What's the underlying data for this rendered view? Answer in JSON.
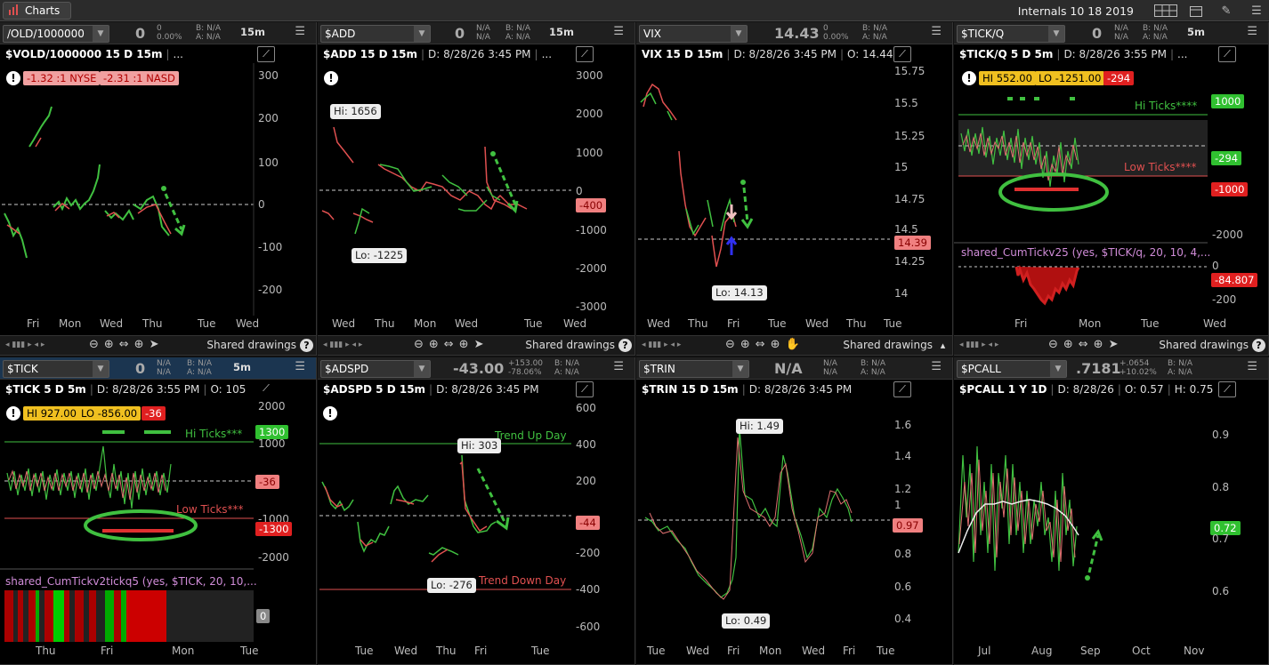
{
  "app": {
    "tab": "Charts",
    "title": "Internals 10 18 2019"
  },
  "panels": [
    {
      "id": "vold",
      "symbol": "/OLD/1000000",
      "bigval": "0",
      "small1": "0",
      "small2": "0.00%",
      "bn": "B: N/A",
      "an": "A: N/A",
      "tf": "15m",
      "status": "$VOLD/1000000 15 D 15m",
      "status_extra": "...",
      "badge1": "-1.32 :1 NYSE",
      "badge2": "-2.31 :1 NASD",
      "yticks": [
        "300",
        "200",
        "100",
        "0",
        "-100",
        "-200"
      ],
      "xticks": [
        "Fri",
        "Mon",
        "Wed",
        "Thu",
        "Tue",
        "Wed"
      ],
      "shared": "Shared drawings"
    },
    {
      "id": "add",
      "symbol": "$ADD",
      "bigval": "0",
      "small1": "N/A",
      "small2": "N/A",
      "bn": "B: N/A",
      "an": "A: N/A",
      "tf": "15m",
      "status": "$ADD 15 D 15m",
      "date": "D: 8/28/26 3:45 PM",
      "status_extra": "...",
      "hi": "Hi: 1656",
      "lo": "Lo: -1225",
      "lastbadge": "-400",
      "yticks": [
        "3000",
        "2000",
        "1000",
        "0",
        "-1000",
        "-2000",
        "-3000"
      ],
      "xticks": [
        "Wed",
        "Thu",
        "Mon",
        "Wed",
        "Tue",
        "Wed"
      ],
      "shared": "Shared drawings"
    },
    {
      "id": "vix",
      "symbol": "VIX",
      "bigval": "14.43",
      "small1": "0",
      "small2": "0.00%",
      "bn": "B: N/A",
      "an": "A: N/A",
      "status": "VIX 15 D 15m",
      "date": "D: 8/28/26 3:45 PM",
      "open": "O: 14.44",
      "lo": "Lo: 14.13",
      "lastbadge": "14.39",
      "yticks": [
        "15.75",
        "15.5",
        "15.25",
        "15",
        "14.75",
        "14.5",
        "14.25",
        "14"
      ],
      "xticks": [
        "Wed",
        "Thu",
        "Fri",
        "Tue",
        "Wed",
        "Thu",
        "Tue"
      ],
      "shared": "Shared drawings"
    },
    {
      "id": "tickq",
      "symbol": "$TICK/Q",
      "bigval": "0",
      "small1": "N/A",
      "small2": "N/A",
      "bn": "B: N/A",
      "an": "A: N/A",
      "tf": "5m",
      "status": "$TICK/Q 5 D 5m",
      "date": "D: 8/28/26 3:55 PM",
      "status_extra": "...",
      "hi": "HI 552.00",
      "lo": "LO -1251.00",
      "last": "-294",
      "hiTicks": "Hi Ticks****",
      "lowTicks": "Low Ticks****",
      "badge1000": "1000",
      "badgeLast": "-294",
      "badgeNeg": "-1000",
      "ytick_2000": "-2000",
      "study": "shared_CumTickv25 (yes, $TICK/q, 20, 10, 4,...",
      "studyVal": "-84.807",
      "studyTicks": [
        "0",
        "-200"
      ],
      "xticks": [
        "Fri",
        "Mon",
        "Tue",
        "Wed"
      ],
      "shared": "Shared drawings"
    },
    {
      "id": "tick",
      "symbol": "$TICK",
      "bigval": "0",
      "small1": "N/A",
      "small2": "N/A",
      "bn": "B: N/A",
      "an": "A: N/A",
      "tf": "5m",
      "status": "$TICK 5 D 5m",
      "date": "D: 8/28/26 3:55 PM",
      "open": "O: 105",
      "hi": "HI 927.00",
      "lo": "LO -856.00",
      "last": "-36",
      "hiTicks": "Hi Ticks***",
      "lowTicks": "Low Ticks***",
      "badge1300": "1300",
      "badgeLast": "-36",
      "badgeNeg": "-1300",
      "yticks": [
        "2000",
        "1000",
        "0",
        "-1000",
        "-2000"
      ],
      "study": "shared_CumTickv2tickq5 (yes, $TICK, 20, 10,...",
      "studyVal": "0",
      "xticks": [
        "Thu",
        "Fri",
        "Mon",
        "Tue"
      ]
    },
    {
      "id": "adspd",
      "symbol": "$ADSPD",
      "bigval": "-43.00",
      "small1": "+153.00",
      "small2": "-78.06%",
      "bn": "B: N/A",
      "an": "A: N/A",
      "status": "$ADSPD 5 D 15m",
      "date": "D: 8/28/26 3:45 PM",
      "hi": "Hi: 303",
      "lo": "Lo: -276",
      "trendUp": "Trend Up Day",
      "trendDown": "Trend Down Day",
      "lastbadge": "-44",
      "yticks": [
        "600",
        "400",
        "200",
        "0",
        "-200",
        "-400",
        "-600"
      ],
      "xticks": [
        "Tue",
        "Wed",
        "Thu",
        "Fri",
        "Tue"
      ]
    },
    {
      "id": "trin",
      "symbol": "$TRIN",
      "bigval": "N/A",
      "small1": "N/A",
      "small2": "N/A",
      "bn": "B: N/A",
      "an": "A: N/A",
      "status": "$TRIN 15 D 15m",
      "date": "D: 8/28/26 3:45 PM",
      "hi": "Hi: 1.49",
      "lo": "Lo: 0.49",
      "lastbadge": "0.97",
      "yticks": [
        "1.6",
        "1.4",
        "1.2",
        "1",
        "0.8",
        "0.6",
        "0.4"
      ],
      "xticks": [
        "Tue",
        "Wed",
        "Fri",
        "Mon",
        "Wed",
        "Fri",
        "Tue"
      ]
    },
    {
      "id": "pcall",
      "symbol": "$PCALL",
      "bigval": ".7181",
      "small1": "+.0654",
      "small2": "+10.02%",
      "bn": "B: N/A",
      "an": "A: N/A",
      "status": "$PCALL 1 Y 1D",
      "date": "D: 8/28/26",
      "open": "O: 0.57",
      "high": "H: 0.75",
      "lastbadge": "0.72",
      "yticks": [
        "0.9",
        "0.8",
        "0.7",
        "0.6"
      ],
      "xticks": [
        "Jul",
        "Aug",
        "Sep",
        "Oct",
        "Nov"
      ]
    }
  ]
}
